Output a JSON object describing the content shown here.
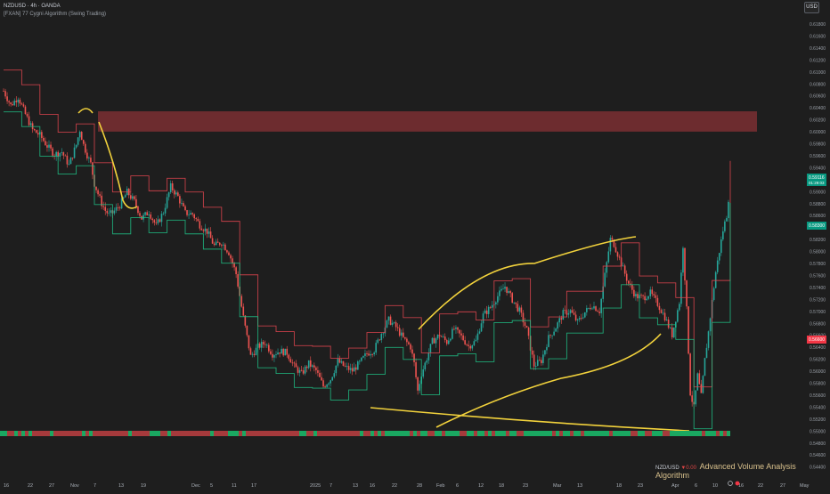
{
  "header": {
    "title": "NZDUSD · 4h · OANDA",
    "subtitle": "[FXAN] 77 Cygni Algorithm (Swing Trading)",
    "currency_button": "USD"
  },
  "footer": {
    "symbol": "NZD/USD",
    "signal": "▼0.00",
    "indicator_name": "Advanced Volume Analysis Algorithm"
  },
  "chart_data": {
    "type": "line",
    "title": "NZDUSD · 4h · OANDA",
    "y_ticks": [
      "0.61800",
      "0.61600",
      "0.61400",
      "0.61200",
      "0.61000",
      "0.60800",
      "0.60600",
      "0.60400",
      "0.60200",
      "0.60000",
      "0.59800",
      "0.59600",
      "0.59400",
      "0.59200",
      "0.59000",
      "0.58800",
      "0.58600",
      "0.58400",
      "0.58200",
      "0.58000",
      "0.57800",
      "0.57600",
      "0.57400",
      "0.57200",
      "0.57000",
      "0.56800",
      "0.56600",
      "0.56400",
      "0.56200",
      "0.56000",
      "0.55800",
      "0.55600",
      "0.55400",
      "0.55200",
      "0.55000",
      "0.54800",
      "0.54600",
      "0.54400"
    ],
    "x_ticks": [
      "16",
      "22",
      "27",
      "Nov",
      "7",
      "13",
      "19",
      "Dec",
      "5",
      "11",
      "17",
      "2025",
      "7",
      "13",
      "16",
      "22",
      "28",
      "Feb",
      "6",
      "12",
      "18",
      "23",
      "Mar",
      "13",
      "18",
      "23",
      "Apr",
      "6",
      "10",
      "16",
      "22",
      "27",
      "May"
    ],
    "ylim": [
      0.544,
      0.619
    ],
    "price_series": [
      {
        "t": 0,
        "v": 0.6068
      },
      {
        "t": 2,
        "v": 0.6044
      },
      {
        "t": 4,
        "v": 0.6058
      },
      {
        "t": 6,
        "v": 0.6029
      },
      {
        "t": 8,
        "v": 0.6003
      },
      {
        "t": 10,
        "v": 0.5994
      },
      {
        "t": 12,
        "v": 0.5976
      },
      {
        "t": 14,
        "v": 0.5962
      },
      {
        "t": 16,
        "v": 0.5966
      },
      {
        "t": 18,
        "v": 0.5944
      },
      {
        "t": 20,
        "v": 0.5978
      },
      {
        "t": 21,
        "v": 0.6003
      },
      {
        "t": 22,
        "v": 0.5978
      },
      {
        "t": 23,
        "v": 0.5961
      },
      {
        "t": 24,
        "v": 0.5946
      },
      {
        "t": 25,
        "v": 0.5913
      },
      {
        "t": 26,
        "v": 0.5896
      },
      {
        "t": 27,
        "v": 0.588
      },
      {
        "t": 28,
        "v": 0.5868
      },
      {
        "t": 29,
        "v": 0.5861
      },
      {
        "t": 30,
        "v": 0.5864
      },
      {
        "t": 32,
        "v": 0.5877
      },
      {
        "t": 34,
        "v": 0.5899
      },
      {
        "t": 36,
        "v": 0.5883
      },
      {
        "t": 38,
        "v": 0.5855
      },
      {
        "t": 40,
        "v": 0.5866
      },
      {
        "t": 42,
        "v": 0.5842
      },
      {
        "t": 44,
        "v": 0.5866
      },
      {
        "t": 46,
        "v": 0.5908
      },
      {
        "t": 48,
        "v": 0.5891
      },
      {
        "t": 50,
        "v": 0.5864
      },
      {
        "t": 52,
        "v": 0.5862
      },
      {
        "t": 54,
        "v": 0.5844
      },
      {
        "t": 56,
        "v": 0.5833
      },
      {
        "t": 58,
        "v": 0.5809
      },
      {
        "t": 60,
        "v": 0.5815
      },
      {
        "t": 62,
        "v": 0.5798
      },
      {
        "t": 64,
        "v": 0.5762
      },
      {
        "t": 66,
        "v": 0.5689
      },
      {
        "t": 68,
        "v": 0.5624
      },
      {
        "t": 70,
        "v": 0.564
      },
      {
        "t": 72,
        "v": 0.5647
      },
      {
        "t": 74,
        "v": 0.5628
      },
      {
        "t": 76,
        "v": 0.5633
      },
      {
        "t": 78,
        "v": 0.563
      },
      {
        "t": 80,
        "v": 0.5607
      },
      {
        "t": 82,
        "v": 0.5595
      },
      {
        "t": 84,
        "v": 0.5612
      },
      {
        "t": 86,
        "v": 0.56
      },
      {
        "t": 88,
        "v": 0.5574
      },
      {
        "t": 90,
        "v": 0.5586
      },
      {
        "t": 92,
        "v": 0.5616
      },
      {
        "t": 94,
        "v": 0.5606
      },
      {
        "t": 96,
        "v": 0.56
      },
      {
        "t": 98,
        "v": 0.5613
      },
      {
        "t": 100,
        "v": 0.5629
      },
      {
        "t": 102,
        "v": 0.5635
      },
      {
        "t": 104,
        "v": 0.5663
      },
      {
        "t": 106,
        "v": 0.5685
      },
      {
        "t": 108,
        "v": 0.5673
      },
      {
        "t": 110,
        "v": 0.5654
      },
      {
        "t": 112,
        "v": 0.564
      },
      {
        "t": 113,
        "v": 0.5612
      },
      {
        "t": 114,
        "v": 0.5566
      },
      {
        "t": 115,
        "v": 0.5595
      },
      {
        "t": 116,
        "v": 0.5612
      },
      {
        "t": 118,
        "v": 0.5649
      },
      {
        "t": 120,
        "v": 0.566
      },
      {
        "t": 122,
        "v": 0.5648
      },
      {
        "t": 124,
        "v": 0.567
      },
      {
        "t": 126,
        "v": 0.5657
      },
      {
        "t": 128,
        "v": 0.5641
      },
      {
        "t": 130,
        "v": 0.565
      },
      {
        "t": 132,
        "v": 0.5693
      },
      {
        "t": 134,
        "v": 0.5706
      },
      {
        "t": 136,
        "v": 0.5725
      },
      {
        "t": 138,
        "v": 0.5741
      },
      {
        "t": 140,
        "v": 0.5719
      },
      {
        "t": 142,
        "v": 0.57
      },
      {
        "t": 144,
        "v": 0.5668
      },
      {
        "t": 146,
        "v": 0.5609
      },
      {
        "t": 148,
        "v": 0.5617
      },
      {
        "t": 150,
        "v": 0.5655
      },
      {
        "t": 152,
        "v": 0.5673
      },
      {
        "t": 154,
        "v": 0.5696
      },
      {
        "t": 156,
        "v": 0.57
      },
      {
        "t": 158,
        "v": 0.5681
      },
      {
        "t": 160,
        "v": 0.5698
      },
      {
        "t": 162,
        "v": 0.571
      },
      {
        "t": 164,
        "v": 0.57
      },
      {
        "t": 166,
        "v": 0.578
      },
      {
        "t": 167,
        "v": 0.582
      },
      {
        "t": 168,
        "v": 0.5812
      },
      {
        "t": 170,
        "v": 0.5779
      },
      {
        "t": 172,
        "v": 0.5746
      },
      {
        "t": 174,
        "v": 0.5725
      },
      {
        "t": 176,
        "v": 0.5722
      },
      {
        "t": 178,
        "v": 0.573
      },
      {
        "t": 180,
        "v": 0.5712
      },
      {
        "t": 182,
        "v": 0.569
      },
      {
        "t": 184,
        "v": 0.566
      },
      {
        "t": 186,
        "v": 0.5715
      },
      {
        "t": 187,
        "v": 0.581
      },
      {
        "t": 188,
        "v": 0.5702
      },
      {
        "t": 189,
        "v": 0.5563
      },
      {
        "t": 190,
        "v": 0.5538
      },
      {
        "t": 191,
        "v": 0.5592
      },
      {
        "t": 192,
        "v": 0.5557
      },
      {
        "t": 193,
        "v": 0.5618
      },
      {
        "t": 194,
        "v": 0.5665
      },
      {
        "t": 195,
        "v": 0.5716
      },
      {
        "t": 196,
        "v": 0.5765
      },
      {
        "t": 197,
        "v": 0.58
      },
      {
        "t": 198,
        "v": 0.5835
      },
      {
        "t": 199,
        "v": 0.586
      },
      {
        "t": 200,
        "v": 0.5916
      }
    ],
    "resistance_zone": {
      "low": 0.6,
      "high": 0.6034
    },
    "price_labels": [
      {
        "value": "0.59116",
        "sub": "01:29:03",
        "color": "#089981"
      },
      {
        "value": "0.58300",
        "sub": "",
        "color": "#089981"
      },
      {
        "value": "0.56600",
        "sub": "",
        "color": "#f23645"
      }
    ],
    "colors": {
      "up": "#26a69a",
      "down": "#ef5350",
      "zone": "#7b2f33",
      "annotation": "#f2d23c"
    }
  }
}
